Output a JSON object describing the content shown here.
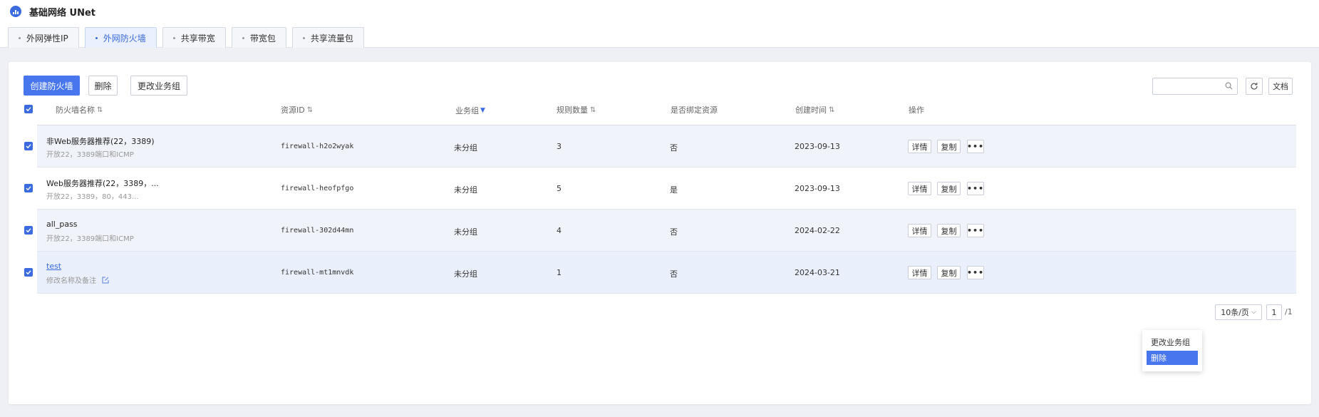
{
  "app": {
    "title": "基础网络 UNet"
  },
  "tabs": [
    {
      "label": "外网弹性IP"
    },
    {
      "label": "外网防火墙"
    },
    {
      "label": "共享带宽"
    },
    {
      "label": "带宽包"
    },
    {
      "label": "共享流量包"
    }
  ],
  "toolbar": {
    "create_label": "创建防火墙",
    "delete_label": "删除",
    "change_group_label": "更改业务组",
    "search_placeholder": "",
    "refresh_icon": "refresh-icon",
    "docs_label": "文档"
  },
  "table": {
    "columns": [
      "防火墙名称",
      "资源ID",
      "业务组",
      "规则数量",
      "是否绑定资源",
      "创建时间",
      "操作"
    ],
    "rows": [
      {
        "name": "非Web服务器推荐(22，3389)",
        "desc": "开放22，3389端口和ICMP",
        "id": "firewall-h2o2wyak",
        "group": "未分组",
        "rules": "3",
        "bound": "否",
        "created": "2023-09-13"
      },
      {
        "name": "Web服务器推荐(22，3389，...",
        "desc": "开放22，3389，80，443...",
        "id": "firewall-heofpfgo",
        "group": "未分组",
        "rules": "5",
        "bound": "是",
        "created": "2023-09-13"
      },
      {
        "name": "all_pass",
        "desc": "开放22，3389端口和ICMP",
        "id": "firewall-302d44mn",
        "group": "未分组",
        "rules": "4",
        "bound": "否",
        "created": "2024-02-22"
      },
      {
        "name": "test",
        "desc": "修改名称及备注",
        "id": "firewall-mt1mnvdk",
        "group": "未分组",
        "rules": "1",
        "bound": "否",
        "created": "2024-03-21"
      }
    ],
    "actions": {
      "detail": "详情",
      "copy": "复制",
      "more": "•••"
    }
  },
  "dropdown": {
    "items": [
      "更改业务组",
      "删除"
    ],
    "selected": "删除"
  },
  "pagination": {
    "page_size": "10条/页",
    "page": "1",
    "total": "/1"
  },
  "colors": {
    "accent": "#4876ee",
    "link": "#3b6bdf"
  }
}
